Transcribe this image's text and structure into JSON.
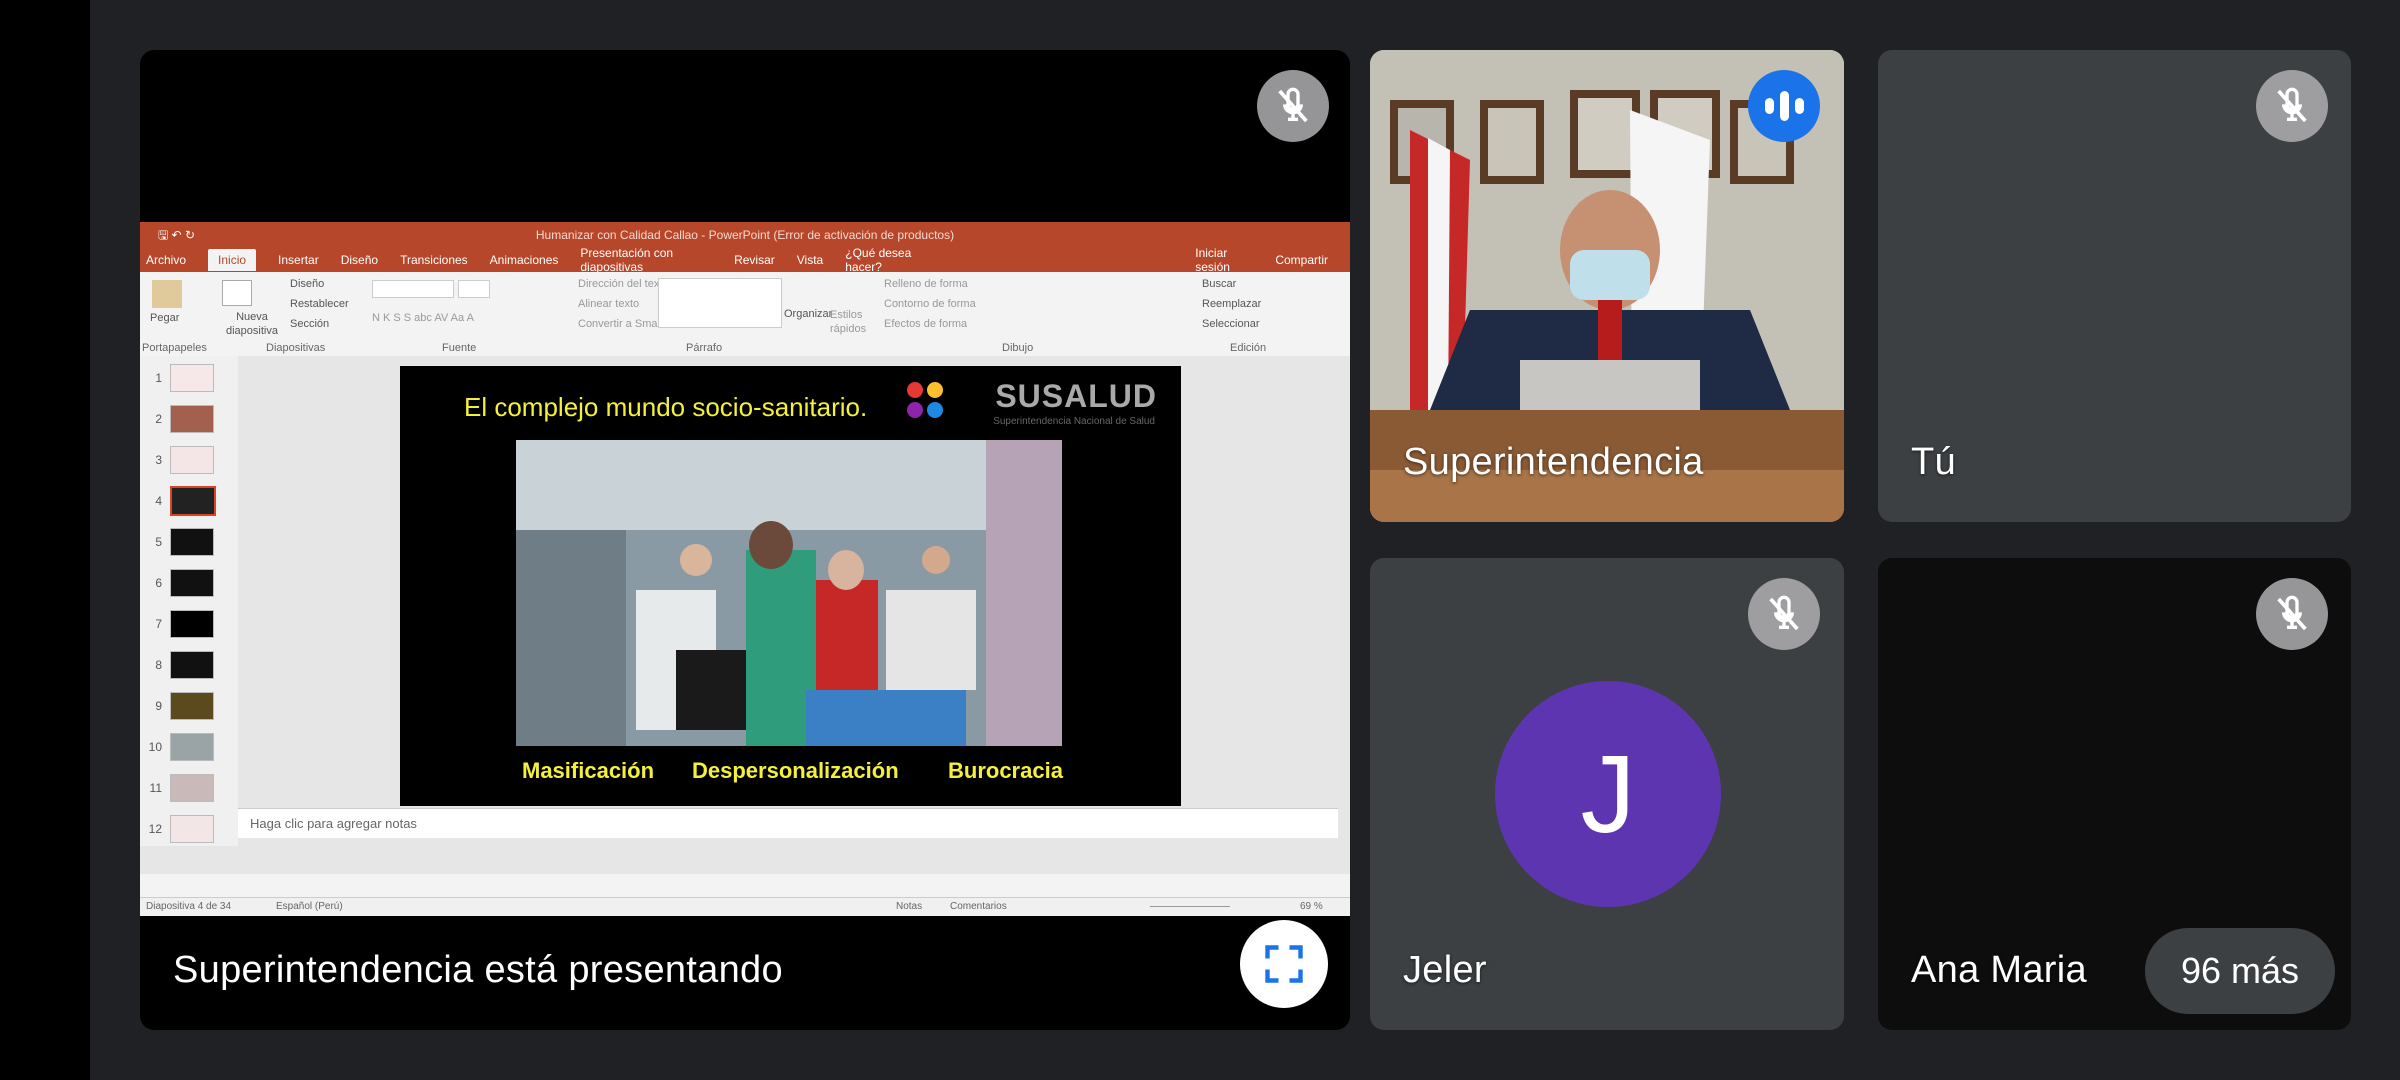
{
  "tiles": {
    "presentation": {
      "label": "Superintendencia está presentando"
    },
    "speaker": {
      "name": "Superintendencia"
    },
    "self": {
      "name": "Tú"
    },
    "jeler": {
      "name": "Jeler",
      "initial": "J"
    },
    "ana": {
      "name": "Ana Maria"
    },
    "more": {
      "label": "96 más"
    }
  },
  "ppt": {
    "window_title": "Humanizar con Calidad Callao - PowerPoint (Error de activación de productos)",
    "tabs": [
      "Archivo",
      "Inicio",
      "Insertar",
      "Diseño",
      "Transiciones",
      "Animaciones",
      "Presentación con diapositivas",
      "Revisar",
      "Vista",
      "¿Qué desea hacer?"
    ],
    "active_tab": "Inicio",
    "sign_in": "Iniciar sesión",
    "share": "Compartir",
    "ribbon": {
      "paste": "Pegar",
      "new_slide": "Nueva diapositiva",
      "layout": "Diseño",
      "reset": "Restablecer",
      "section": "Sección",
      "text_direction": "Dirección del texto",
      "align_text": "Alinear texto",
      "smartart": "Convertir a SmartArt",
      "arrange": "Organizar",
      "quick_styles": "Estilos rápidos",
      "shape_fill": "Relleno de forma",
      "shape_outline": "Contorno de forma",
      "shape_effects": "Efectos de forma",
      "find": "Buscar",
      "replace": "Reemplazar",
      "select": "Seleccionar",
      "groups": [
        "Portapapeles",
        "Diapositivas",
        "Fuente",
        "Párrafo",
        "Dibujo",
        "Edición"
      ]
    },
    "thumbnails": [
      "1",
      "2",
      "3",
      "4",
      "5",
      "6",
      "7",
      "8",
      "9",
      "10",
      "11",
      "12"
    ],
    "slide": {
      "title": "El complejo mundo socio-sanitario.",
      "logo": "SUSALUD",
      "logo_sub": "Superintendencia Nacional de Salud",
      "words": [
        "Masificación",
        "Despersonalización",
        "Burocracia"
      ]
    },
    "notes_placeholder": "Haga clic para agregar notas",
    "status": {
      "slide_counter": "Diapositiva 4 de 34",
      "language": "Español (Perú)",
      "notes": "Notas",
      "comments": "Comentarios",
      "zoom": "69 %"
    }
  },
  "colors": {
    "background": "#202124",
    "tile": "#3c4043",
    "speaking": "#1a73e8",
    "avatar": "#5e35b1",
    "ppt_accent": "#b7472a"
  },
  "icons": [
    "mic-off-icon",
    "speaking-icon",
    "fullscreen-icon"
  ]
}
